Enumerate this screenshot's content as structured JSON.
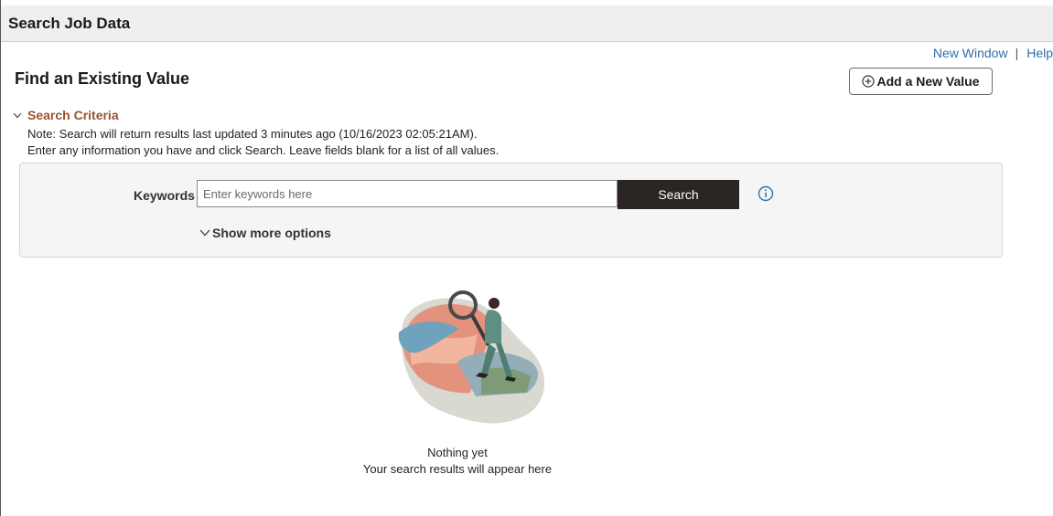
{
  "page": {
    "header_title": "Search Job Data"
  },
  "top_links": {
    "new_window": "New Window",
    "separator": "|",
    "help": "Help"
  },
  "main": {
    "title": "Find an Existing Value",
    "add_button_label": "Add a New Value",
    "search_criteria": {
      "label": "Search Criteria",
      "note1": "Note: Search will return results last updated 3 minutes ago (10/16/2023 02:05:21AM).",
      "note2": "Enter any information you have and click Search. Leave fields blank for a list of all values.",
      "keywords_label": "Keywords",
      "keywords_placeholder": "Enter keywords here",
      "keywords_value": "",
      "search_button": "Search",
      "show_more": "Show more options"
    },
    "empty_state": {
      "title": "Nothing yet",
      "subtitle": "Your search results will appear here"
    }
  },
  "icons": {
    "add": "circle-plus-icon",
    "criteria_toggle": "chevron-down-icon",
    "info": "info-circle-icon",
    "more_options": "chevron-down-icon"
  },
  "colors": {
    "link": "#2f6fad",
    "criteria_accent": "#9a5431",
    "search_button_bg": "#2b2624",
    "header_bg": "#efefef",
    "panel_bg": "#f5f5f5"
  }
}
